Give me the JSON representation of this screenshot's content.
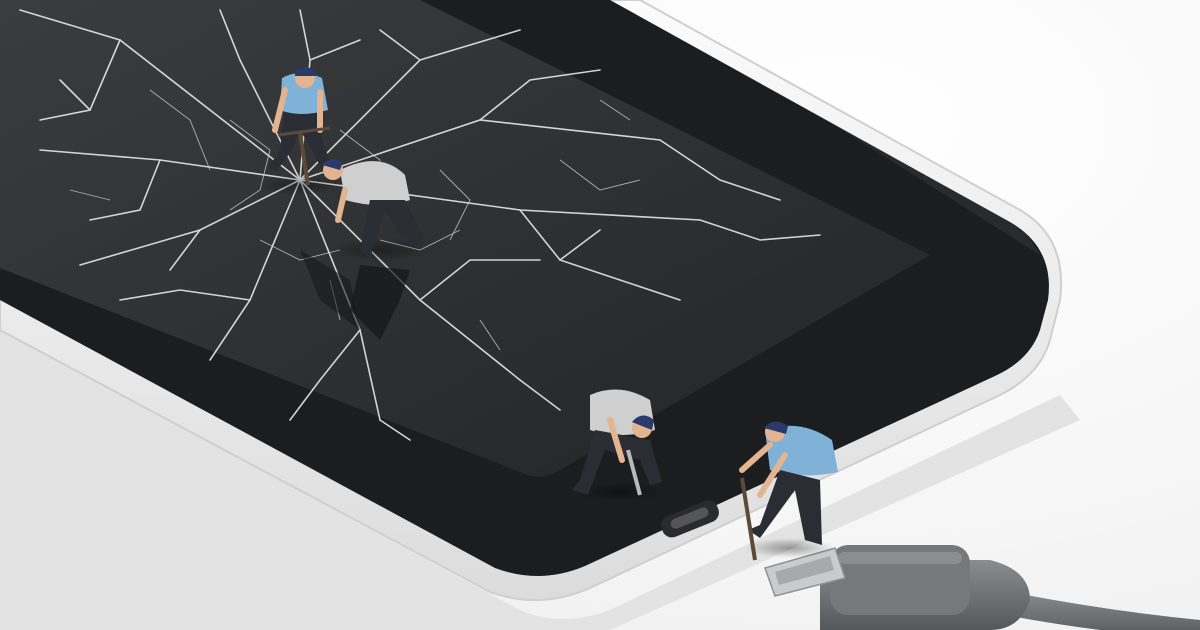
{
  "image": {
    "subject": "smartphone",
    "palette": {
      "background": "#ffffff",
      "phone_body": "#f3f3f3",
      "screen": "#2f3133",
      "cracks": "#e8e8e8",
      "worker_shirt_blue": "#7fb2d6",
      "worker_shirt_grey": "#cfcfcf",
      "worker_pants": "#2a2d33",
      "cable": "#6f7275",
      "usb_metal": "#c9cbcd"
    }
  }
}
